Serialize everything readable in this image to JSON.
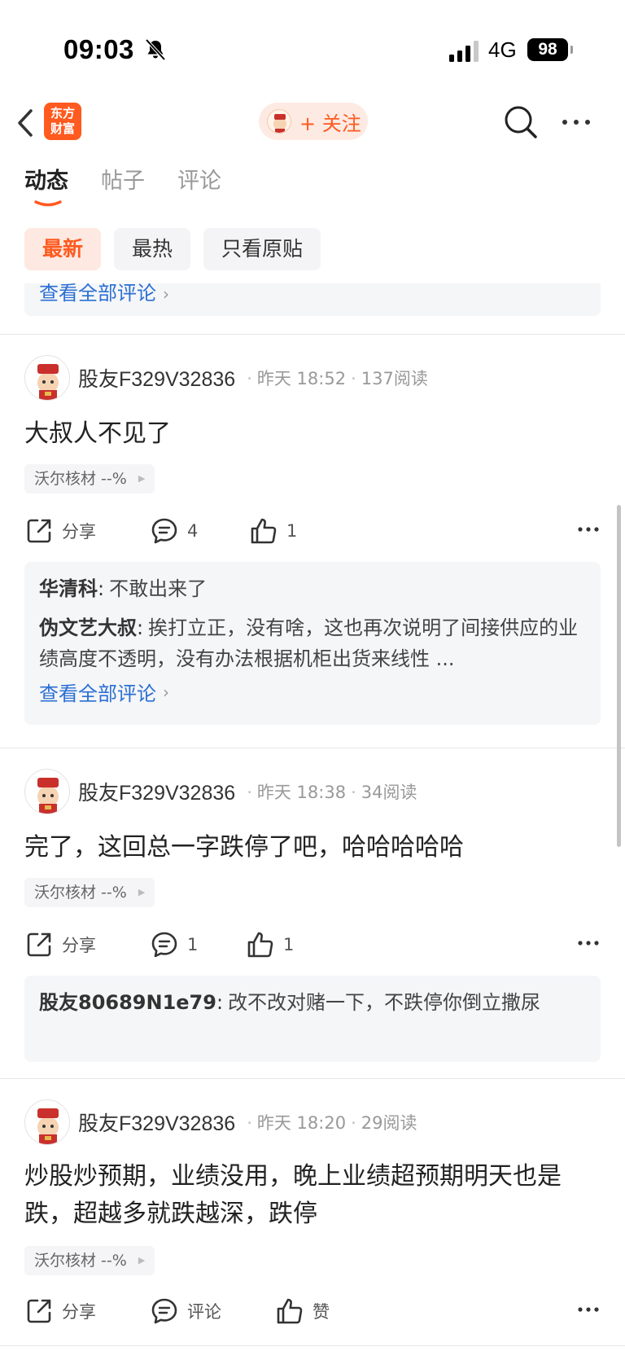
{
  "status_bar": {
    "time": "09:03",
    "network": "4G",
    "battery": "98"
  },
  "nav": {
    "brand_line1": "东方",
    "brand_line2": "财富",
    "follow_label": "+ 关注"
  },
  "tabs": [
    {
      "label": "动态",
      "active": true
    },
    {
      "label": "帖子",
      "active": false
    },
    {
      "label": "评论",
      "active": false
    }
  ],
  "filters": [
    {
      "label": "最新",
      "active": true
    },
    {
      "label": "最热",
      "active": false
    },
    {
      "label": "只看原贴",
      "active": false
    }
  ],
  "partial_box": {
    "view_all": "查看全部评论"
  },
  "posts": [
    {
      "user": "股友F329V32836",
      "time": "昨天 18:52",
      "reads": "137阅读",
      "text": "大叔人不见了",
      "stock": "沃尔核材 --%",
      "share_label": "分享",
      "comment_count": "4",
      "like_count": "1",
      "comments": [
        {
          "user": "华清科",
          "sep": ":",
          "text": "不敢出来了"
        },
        {
          "user": "伪文艺大叔",
          "sep": ":",
          "text": "挨打立正，没有啥，这也再次说明了间接供应的业绩高度不透明，没有办法根据机柜出货来线性 ..."
        }
      ],
      "view_all": "查看全部评论"
    },
    {
      "user": "股友F329V32836",
      "time": "昨天 18:38",
      "reads": "34阅读",
      "text": "完了，这回总一字跌停了吧，哈哈哈哈哈",
      "stock": "沃尔核材 --%",
      "share_label": "分享",
      "comment_count": "1",
      "like_count": "1",
      "comments": [
        {
          "user": "股友80689N1e79",
          "sep": ":",
          "text": "改不改对赌一下，不跌停你倒立撒尿"
        }
      ]
    },
    {
      "user": "股友F329V32836",
      "time": "昨天 18:20",
      "reads": "29阅读",
      "text": "炒股炒预期，业绩没用，晚上业绩超预期明天也是跌，超越多就跌越深，跌停",
      "stock": "沃尔核材 --%",
      "share_label": "分享",
      "comment_label": "评论",
      "like_label": "赞"
    }
  ],
  "colors": {
    "accent": "#ff5a1f",
    "link": "#2b6fd4",
    "box_bg": "#f5f6f8"
  }
}
